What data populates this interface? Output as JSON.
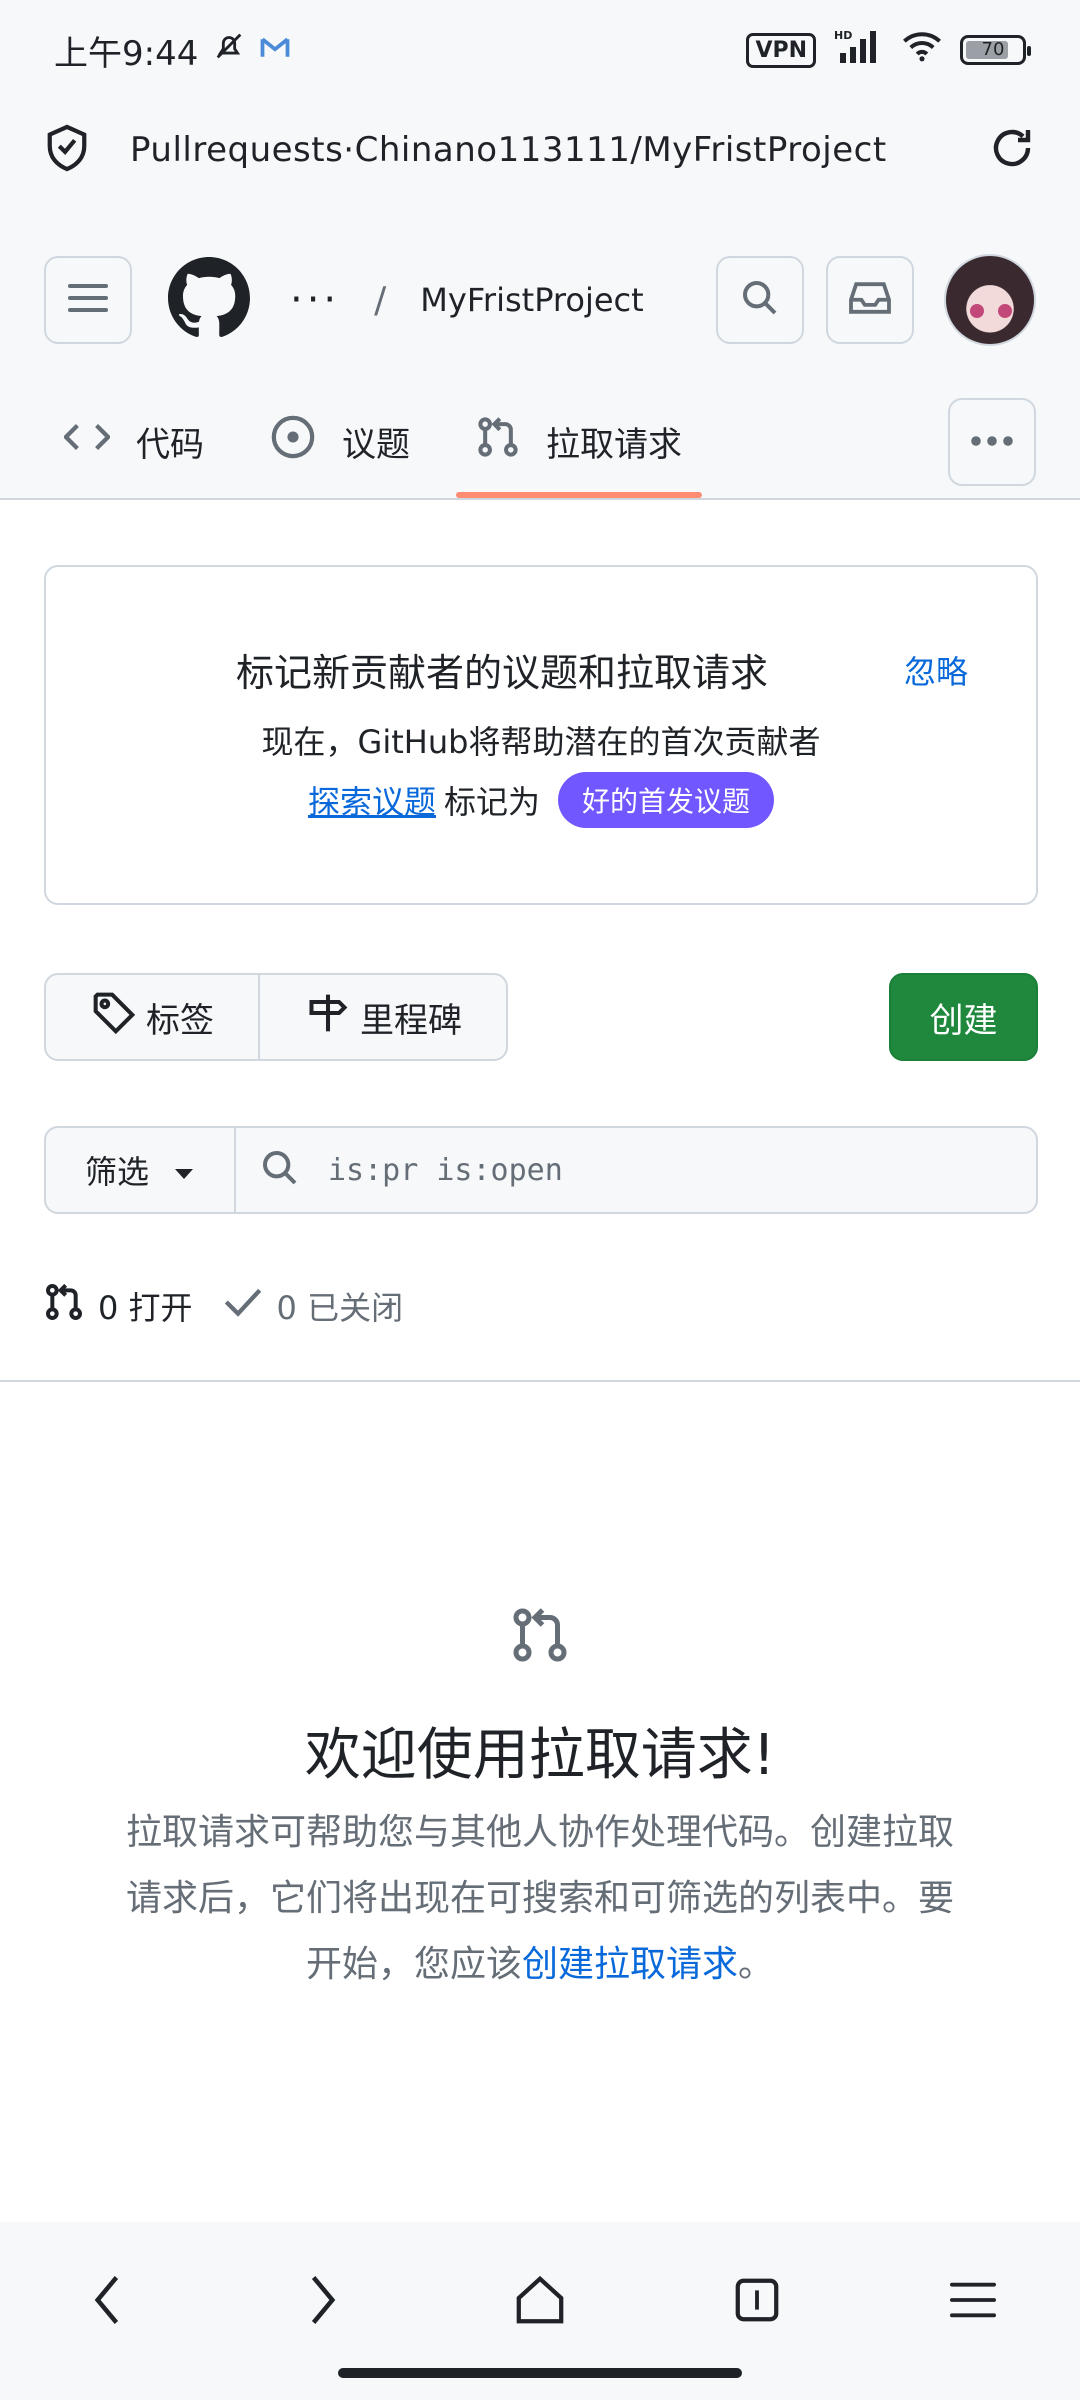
{
  "status_bar": {
    "time": "上午9:44",
    "vpn": "VPN",
    "network": "HD",
    "battery": "70"
  },
  "url_bar": {
    "url": "Pullrequests·Chinano113111/MyFristProject"
  },
  "header": {
    "ellipsis": "···",
    "separator": "/",
    "repo_name": "MyFristProject"
  },
  "tabs": [
    {
      "label": "代码",
      "icon": "code-icon"
    },
    {
      "label": "议题",
      "icon": "issue-opened-icon"
    },
    {
      "label": "拉取请求",
      "icon": "git-pull-request-icon",
      "active": true
    }
  ],
  "banner": {
    "title": "标记新贡献者的议题和拉取请求",
    "dismiss": "忽略",
    "line1": "现在，GitHub将帮助潜在的首次贡献者",
    "link": "探索议题",
    "line2_mid": "标记为",
    "label": "好的首发议题"
  },
  "toolbar": {
    "labels": "标签",
    "milestones": "里程碑",
    "create": "创建"
  },
  "filter": {
    "label": "筛选",
    "search_placeholder": "is:pr is:open"
  },
  "counts": {
    "open": "0 打开",
    "closed": "0 已关闭"
  },
  "blankslate": {
    "title": "欢迎使用拉取请求!",
    "text": "拉取请求可帮助您与其他人协作处理代码。创建拉取请求后，它们将出现在可搜索和可筛选的列表中。要开始，您应该",
    "link": "创建拉取请求",
    "end": "。"
  },
  "colors": {
    "accent": "#0969da",
    "create_green": "#1f883d",
    "label_purple": "#7057ff",
    "tab_underline": "#fd8c73"
  }
}
